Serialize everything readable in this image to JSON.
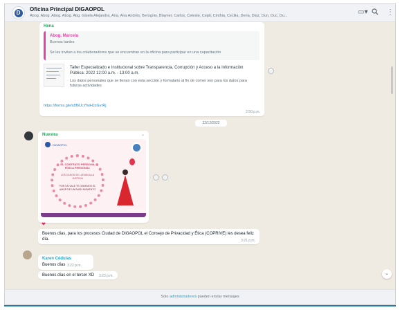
{
  "header": {
    "group_name": "Oficina Principal DIGAOPOL",
    "members": "Abog. Abog. Abog. Abog. Abg. Gisela Alejandra, Ana, Ana Andrés, Berognis, Blayner, Carlos, Celeste, Cepti, Cinthia, Cecilia, Deria, Diaz, Dun, Duc, Du...",
    "icons": [
      "video-icon",
      "search-icon",
      "menu-icon"
    ]
  },
  "messages": {
    "first": {
      "sender": "Hena",
      "quote_author": "Abog. Marcela",
      "quote_line1": "Buenos tardes",
      "quote_line2": "Se les invitan a los colaboradores que se encuentran en la oficina para participar en una capacitación",
      "preview_title": "Taller Especializado e Institucional sobre Transparencia, Corrupción y Acceso a la Información Pública: 2022 12:00 a.m. - 13:00 a.m.",
      "preview_desc": "Los datos personales que se llenan con esta sección y formulario al fin de comer son para los datos para futuras actividades",
      "link": "https://forms.gle/x8f6UcYfwHJzGvrRj",
      "time": "2:50 p.m."
    },
    "date_chip": "22/12/2022",
    "image": {
      "sender": "Nuestra",
      "poster_logo": "DIGAOPOL",
      "poster_title": "EL CONTRATO PERSONA FÍSICA PERSONAL",
      "poster_sub": "LOS CASOS SE LLEVAN A LA JUSTICIA",
      "poster_note": "POR UN VALE TE DEBEMOS EL AMOR DE UN BUEN MOMENTO",
      "time": "3:20 p.m.",
      "reaction": "❤"
    },
    "third": {
      "text": "Buenos días, para los procesos Ciudad de DIGAOPOL el Consejo de Privacidad y Ética (COPRIVE) les desea feliz día.",
      "time": "3:21 p.m."
    },
    "fourth": {
      "sender": "Karen Cédulas",
      "text": "Buenos días",
      "time": "3:22 p.m."
    },
    "fifth": {
      "text": "Buenos días en el tercer XD",
      "time": "3:23 p.m."
    }
  },
  "footer": {
    "prefix": "Solo ",
    "admins": "administradores",
    "suffix": " pueden enviar mensajes"
  },
  "scroll_down_icon": "chevron-down-icon"
}
